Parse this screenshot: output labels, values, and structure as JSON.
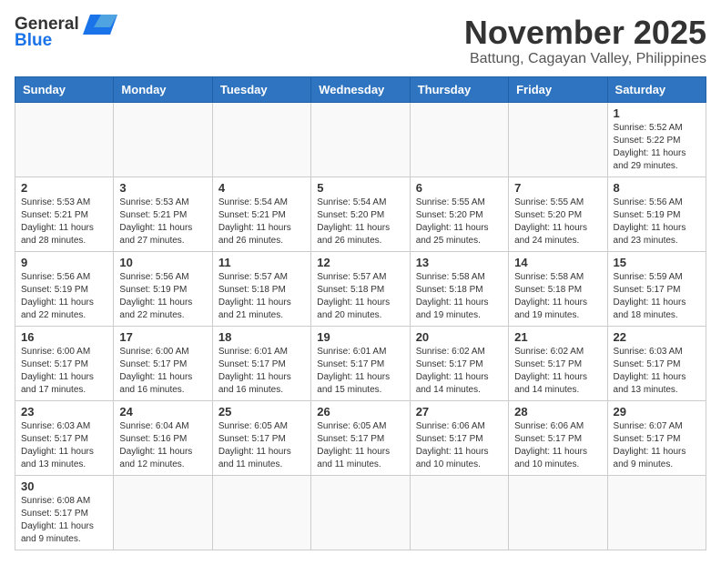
{
  "header": {
    "logo_general": "General",
    "logo_blue": "Blue",
    "month": "November 2025",
    "location": "Battung, Cagayan Valley, Philippines"
  },
  "days_of_week": [
    "Sunday",
    "Monday",
    "Tuesday",
    "Wednesday",
    "Thursday",
    "Friday",
    "Saturday"
  ],
  "weeks": [
    [
      {
        "day": "",
        "content": ""
      },
      {
        "day": "",
        "content": ""
      },
      {
        "day": "",
        "content": ""
      },
      {
        "day": "",
        "content": ""
      },
      {
        "day": "",
        "content": ""
      },
      {
        "day": "",
        "content": ""
      },
      {
        "day": "1",
        "content": "Sunrise: 5:52 AM\nSunset: 5:22 PM\nDaylight: 11 hours and 29 minutes."
      }
    ],
    [
      {
        "day": "2",
        "content": "Sunrise: 5:53 AM\nSunset: 5:21 PM\nDaylight: 11 hours and 28 minutes."
      },
      {
        "day": "3",
        "content": "Sunrise: 5:53 AM\nSunset: 5:21 PM\nDaylight: 11 hours and 27 minutes."
      },
      {
        "day": "4",
        "content": "Sunrise: 5:54 AM\nSunset: 5:21 PM\nDaylight: 11 hours and 26 minutes."
      },
      {
        "day": "5",
        "content": "Sunrise: 5:54 AM\nSunset: 5:20 PM\nDaylight: 11 hours and 26 minutes."
      },
      {
        "day": "6",
        "content": "Sunrise: 5:55 AM\nSunset: 5:20 PM\nDaylight: 11 hours and 25 minutes."
      },
      {
        "day": "7",
        "content": "Sunrise: 5:55 AM\nSunset: 5:20 PM\nDaylight: 11 hours and 24 minutes."
      },
      {
        "day": "8",
        "content": "Sunrise: 5:56 AM\nSunset: 5:19 PM\nDaylight: 11 hours and 23 minutes."
      }
    ],
    [
      {
        "day": "9",
        "content": "Sunrise: 5:56 AM\nSunset: 5:19 PM\nDaylight: 11 hours and 22 minutes."
      },
      {
        "day": "10",
        "content": "Sunrise: 5:56 AM\nSunset: 5:19 PM\nDaylight: 11 hours and 22 minutes."
      },
      {
        "day": "11",
        "content": "Sunrise: 5:57 AM\nSunset: 5:18 PM\nDaylight: 11 hours and 21 minutes."
      },
      {
        "day": "12",
        "content": "Sunrise: 5:57 AM\nSunset: 5:18 PM\nDaylight: 11 hours and 20 minutes."
      },
      {
        "day": "13",
        "content": "Sunrise: 5:58 AM\nSunset: 5:18 PM\nDaylight: 11 hours and 19 minutes."
      },
      {
        "day": "14",
        "content": "Sunrise: 5:58 AM\nSunset: 5:18 PM\nDaylight: 11 hours and 19 minutes."
      },
      {
        "day": "15",
        "content": "Sunrise: 5:59 AM\nSunset: 5:17 PM\nDaylight: 11 hours and 18 minutes."
      }
    ],
    [
      {
        "day": "16",
        "content": "Sunrise: 6:00 AM\nSunset: 5:17 PM\nDaylight: 11 hours and 17 minutes."
      },
      {
        "day": "17",
        "content": "Sunrise: 6:00 AM\nSunset: 5:17 PM\nDaylight: 11 hours and 16 minutes."
      },
      {
        "day": "18",
        "content": "Sunrise: 6:01 AM\nSunset: 5:17 PM\nDaylight: 11 hours and 16 minutes."
      },
      {
        "day": "19",
        "content": "Sunrise: 6:01 AM\nSunset: 5:17 PM\nDaylight: 11 hours and 15 minutes."
      },
      {
        "day": "20",
        "content": "Sunrise: 6:02 AM\nSunset: 5:17 PM\nDaylight: 11 hours and 14 minutes."
      },
      {
        "day": "21",
        "content": "Sunrise: 6:02 AM\nSunset: 5:17 PM\nDaylight: 11 hours and 14 minutes."
      },
      {
        "day": "22",
        "content": "Sunrise: 6:03 AM\nSunset: 5:17 PM\nDaylight: 11 hours and 13 minutes."
      }
    ],
    [
      {
        "day": "23",
        "content": "Sunrise: 6:03 AM\nSunset: 5:17 PM\nDaylight: 11 hours and 13 minutes."
      },
      {
        "day": "24",
        "content": "Sunrise: 6:04 AM\nSunset: 5:16 PM\nDaylight: 11 hours and 12 minutes."
      },
      {
        "day": "25",
        "content": "Sunrise: 6:05 AM\nSunset: 5:17 PM\nDaylight: 11 hours and 11 minutes."
      },
      {
        "day": "26",
        "content": "Sunrise: 6:05 AM\nSunset: 5:17 PM\nDaylight: 11 hours and 11 minutes."
      },
      {
        "day": "27",
        "content": "Sunrise: 6:06 AM\nSunset: 5:17 PM\nDaylight: 11 hours and 10 minutes."
      },
      {
        "day": "28",
        "content": "Sunrise: 6:06 AM\nSunset: 5:17 PM\nDaylight: 11 hours and 10 minutes."
      },
      {
        "day": "29",
        "content": "Sunrise: 6:07 AM\nSunset: 5:17 PM\nDaylight: 11 hours and 9 minutes."
      }
    ],
    [
      {
        "day": "30",
        "content": "Sunrise: 6:08 AM\nSunset: 5:17 PM\nDaylight: 11 hours and 9 minutes."
      },
      {
        "day": "",
        "content": ""
      },
      {
        "day": "",
        "content": ""
      },
      {
        "day": "",
        "content": ""
      },
      {
        "day": "",
        "content": ""
      },
      {
        "day": "",
        "content": ""
      },
      {
        "day": "",
        "content": ""
      }
    ]
  ]
}
